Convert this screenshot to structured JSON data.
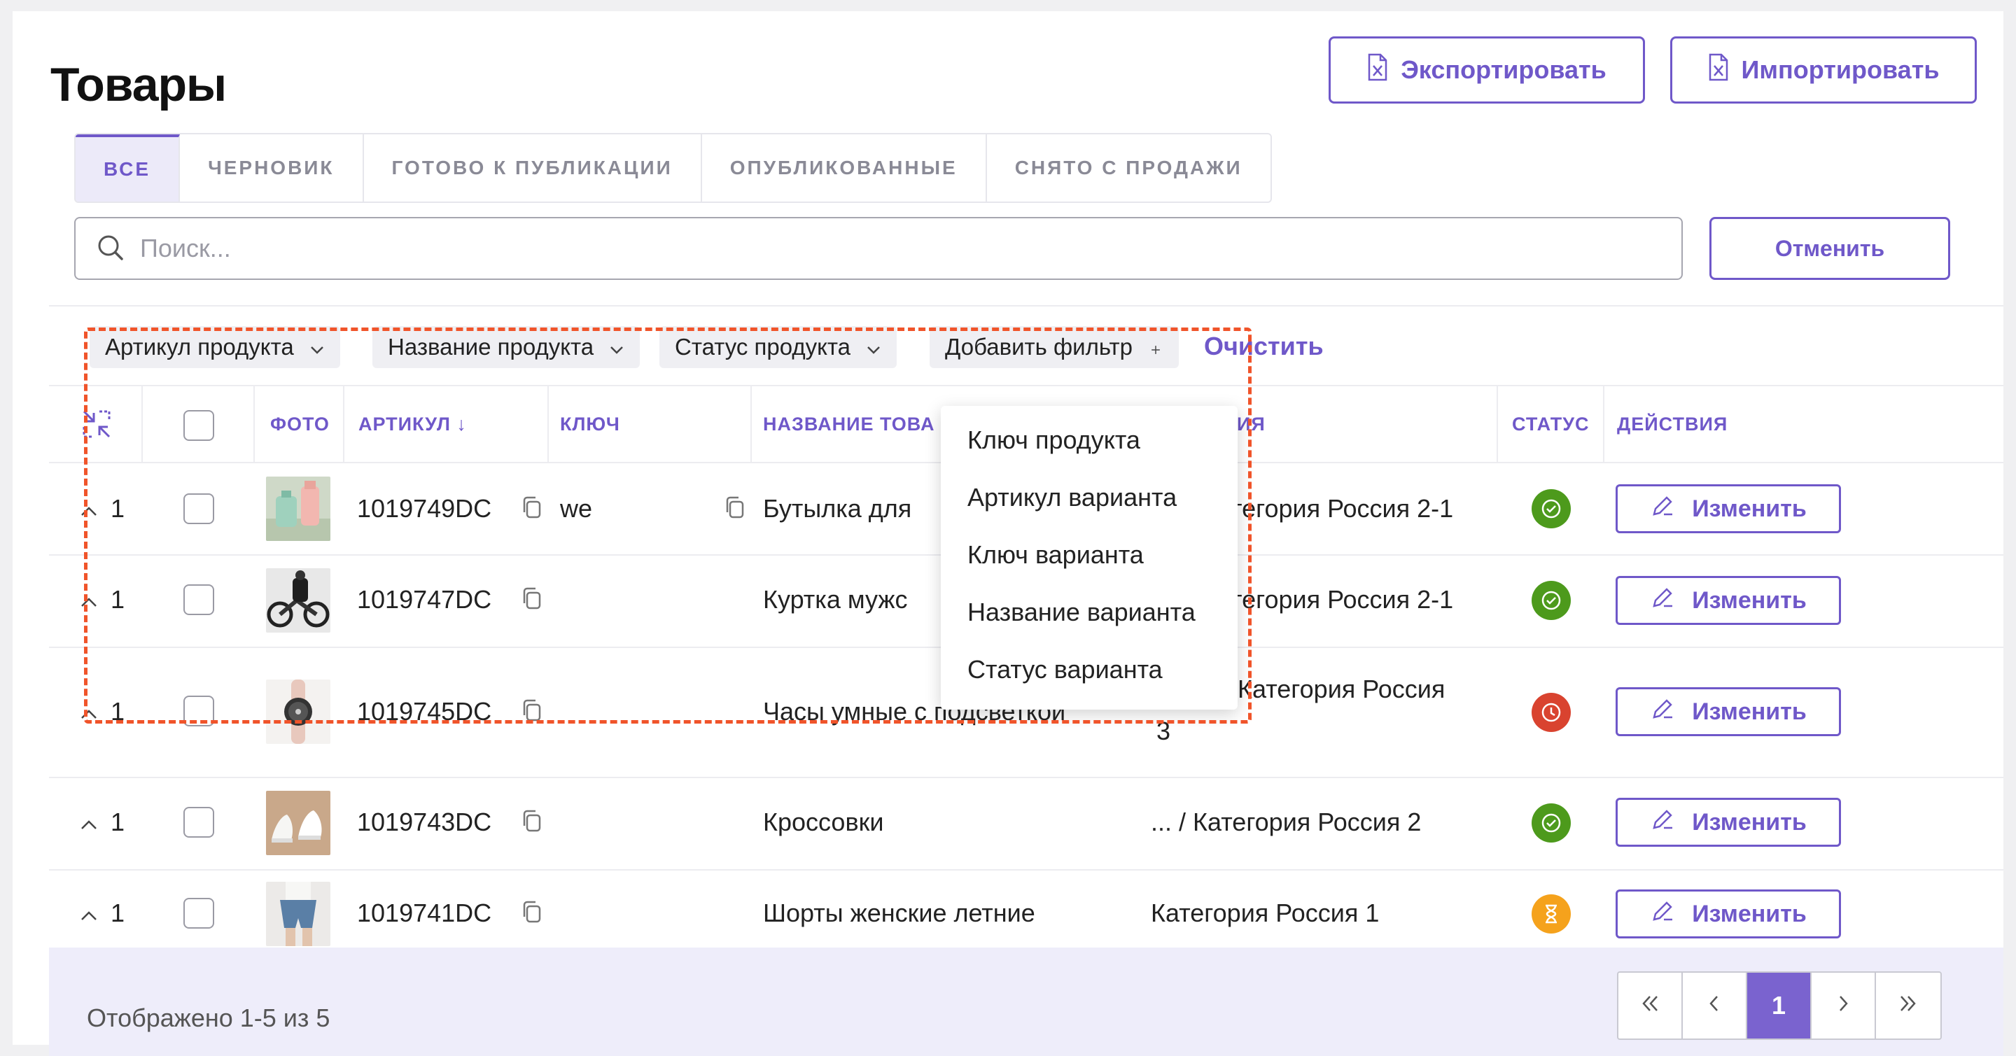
{
  "header": {
    "title": "Товары",
    "export_label": "Экспортировать",
    "import_label": "Импортировать"
  },
  "tabs": [
    {
      "label": "ВСЕ",
      "active": true
    },
    {
      "label": "ЧЕРНОВИК",
      "active": false
    },
    {
      "label": "ГОТОВО К ПУБЛИКАЦИИ",
      "active": false
    },
    {
      "label": "ОПУБЛИКОВАННЫЕ",
      "active": false
    },
    {
      "label": "СНЯТО С ПРОДАЖИ",
      "active": false
    }
  ],
  "search": {
    "placeholder": "Поиск...",
    "value": "",
    "cancel_label": "Отменить"
  },
  "filters": {
    "chips": [
      "Артикул продукта",
      "Название продукта",
      "Статус продукта",
      "Добавить фильтр"
    ],
    "clear_label": "Очистить",
    "add_menu": [
      "Ключ продукта",
      "Артикул варианта",
      "Ключ варианта",
      "Название варианта",
      "Статус варианта"
    ]
  },
  "table": {
    "columns": {
      "photo": "ФОТО",
      "sku": "АРТИКУЛ ↓",
      "key": "КЛЮЧ",
      "name": "НАЗВАНИЕ ТОВА",
      "category": "РИЯ",
      "status": "СТАТУС",
      "actions": "ДЕЙСТВИЯ"
    },
    "rows": [
      {
        "count": "1",
        "sku": "1019749DC",
        "key": "we",
        "name": "Бутылка для",
        "category": "тегория Россия 2-1",
        "category2": "",
        "status": "published",
        "edit": "Изменить"
      },
      {
        "count": "1",
        "sku": "1019747DC",
        "key": "",
        "name": "Куртка мужс",
        "category": "тегория Россия 2-1",
        "category2": "",
        "status": "published",
        "edit": "Изменить"
      },
      {
        "count": "1",
        "sku": "1019745DC",
        "key": "",
        "name": "Часы умные с подсветкой",
        "category": "/ Категория Россия",
        "category2": "3",
        "status": "unpublished",
        "edit": "Изменить"
      },
      {
        "count": "1",
        "sku": "1019743DC",
        "key": "",
        "name": "Кроссовки",
        "category": "... / Категория Россия 2",
        "category2": "",
        "status": "published",
        "edit": "Изменить"
      },
      {
        "count": "1",
        "sku": "1019741DC",
        "key": "",
        "name": "Шорты женские летние",
        "category": "Категория Россия 1",
        "category2": "",
        "status": "pending",
        "edit": "Изменить"
      }
    ]
  },
  "footer": {
    "shown": "Отображено 1-5 из 5",
    "current_page": "1"
  },
  "colors": {
    "accent": "#6f58c9",
    "status_published": "#4d9a1c",
    "status_unpublished": "#d9432f",
    "status_pending": "#f5a21c",
    "highlight": "#f0542a"
  }
}
